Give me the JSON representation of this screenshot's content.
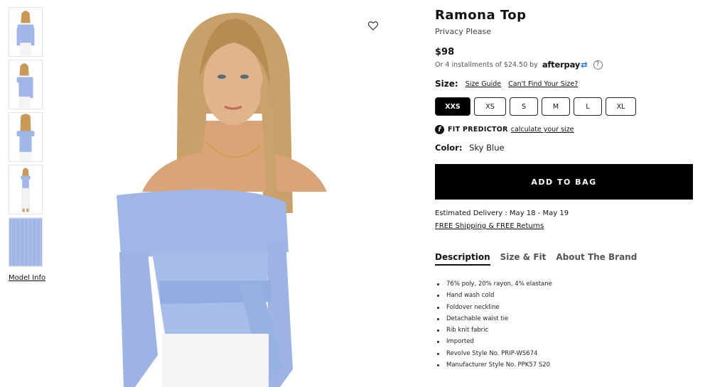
{
  "product": {
    "title": "Ramona Top",
    "brand": "Privacy Please",
    "price": "$98",
    "installments_text": "Or 4 installments of $24.50 by",
    "afterpay_logo": "afterpay",
    "afterpay_mark": "⇄",
    "help_icon": "?"
  },
  "gallery": {
    "thumbnails": [
      {
        "alt": "front view"
      },
      {
        "alt": "angled view"
      },
      {
        "alt": "back view"
      },
      {
        "alt": "full body view"
      },
      {
        "alt": "fabric detail"
      }
    ],
    "model_info_label": "Model Info"
  },
  "size": {
    "label": "Size:",
    "guide_link": "Size Guide",
    "cant_find_link": "Can't Find Your Size?",
    "options": [
      "XXS",
      "XS",
      "S",
      "M",
      "L",
      "XL"
    ],
    "selected": "XXS"
  },
  "fit_predictor": {
    "icon": "f",
    "label": "FIT PREDICTOR",
    "link": "calculate your size"
  },
  "color": {
    "label": "Color:",
    "value": "Sky Blue"
  },
  "cta": {
    "add_to_bag": "ADD TO BAG"
  },
  "delivery": {
    "estimate": "Estimated Delivery : May 18 - May 19",
    "shipping": "FREE Shipping & FREE Returns"
  },
  "tabs": [
    "Description",
    "Size & Fit",
    "About The Brand"
  ],
  "active_tab": "Description",
  "description": [
    "76% poly, 20% rayon, 4% elastane",
    "Hand wash cold",
    "Foldover neckline",
    "Detachable waist tie",
    "Rib knit fabric",
    "Imported",
    "Revolve Style No. PRIP-WS674",
    "Manufacturer Style No. PPK57 S20"
  ],
  "colors": {
    "accent": "#000000",
    "garment": "#9fb6e6",
    "afterpay_blue": "#1c73e8"
  }
}
